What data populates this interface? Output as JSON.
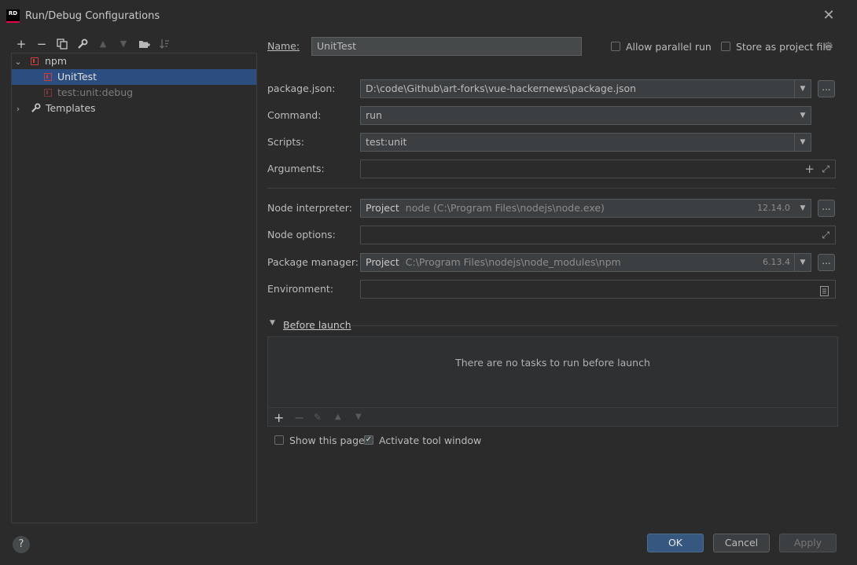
{
  "window": {
    "logo_text": "RD",
    "title": "Run/Debug Configurations",
    "close_glyph": "✕"
  },
  "toolbar": {
    "icons": [
      "add-icon",
      "remove-icon",
      "copy-icon",
      "wrench-icon",
      "move-up-icon",
      "move-down-icon",
      "new-folder-icon",
      "sort-icon"
    ]
  },
  "tree": {
    "group_label": "npm",
    "items": [
      {
        "label": "UnitTest",
        "selected": true
      },
      {
        "label": "test:unit:debug",
        "selected": false
      }
    ],
    "templates_label": "Templates"
  },
  "form": {
    "name_label": "Name:",
    "name_value": "UnitTest",
    "allow_parallel_label": "Allow parallel run",
    "allow_parallel_checked": false,
    "store_project_label": "Store as project file",
    "store_project_checked": false,
    "package_json_label": "package.json:",
    "package_json_value": "D:\\code\\Github\\art-forks\\vue-hackernews\\package.json",
    "command_label": "Command:",
    "command_value": "run",
    "scripts_label": "Scripts:",
    "scripts_value": "test:unit",
    "arguments_label": "Arguments:",
    "arguments_value": "",
    "node_interpreter_label": "Node interpreter:",
    "node_interpreter_prefix": "Project",
    "node_interpreter_value": "node (C:\\Program Files\\nodejs\\node.exe)",
    "node_interpreter_version": "12.14.0",
    "node_options_label": "Node options:",
    "node_options_value": "",
    "package_manager_label": "Package manager:",
    "package_manager_prefix": "Project",
    "package_manager_value": "C:\\Program Files\\nodejs\\node_modules\\npm",
    "package_manager_version": "6.13.4",
    "environment_label": "Environment:",
    "environment_value": "",
    "dots": "..."
  },
  "before_launch": {
    "title": "Before launch",
    "empty_text": "There are no tasks to run before launch"
  },
  "options": {
    "show_page_label": "Show this page",
    "show_page_checked": false,
    "activate_tool_label": "Activate tool window",
    "activate_tool_checked": true
  },
  "buttons": {
    "help": "?",
    "ok": "OK",
    "cancel": "Cancel",
    "apply": "Apply"
  },
  "colors": {
    "background": "#2b2b2b",
    "selection": "#2c4d7f",
    "ok_button": "#365880",
    "npm_red": "#cc3e3e"
  }
}
